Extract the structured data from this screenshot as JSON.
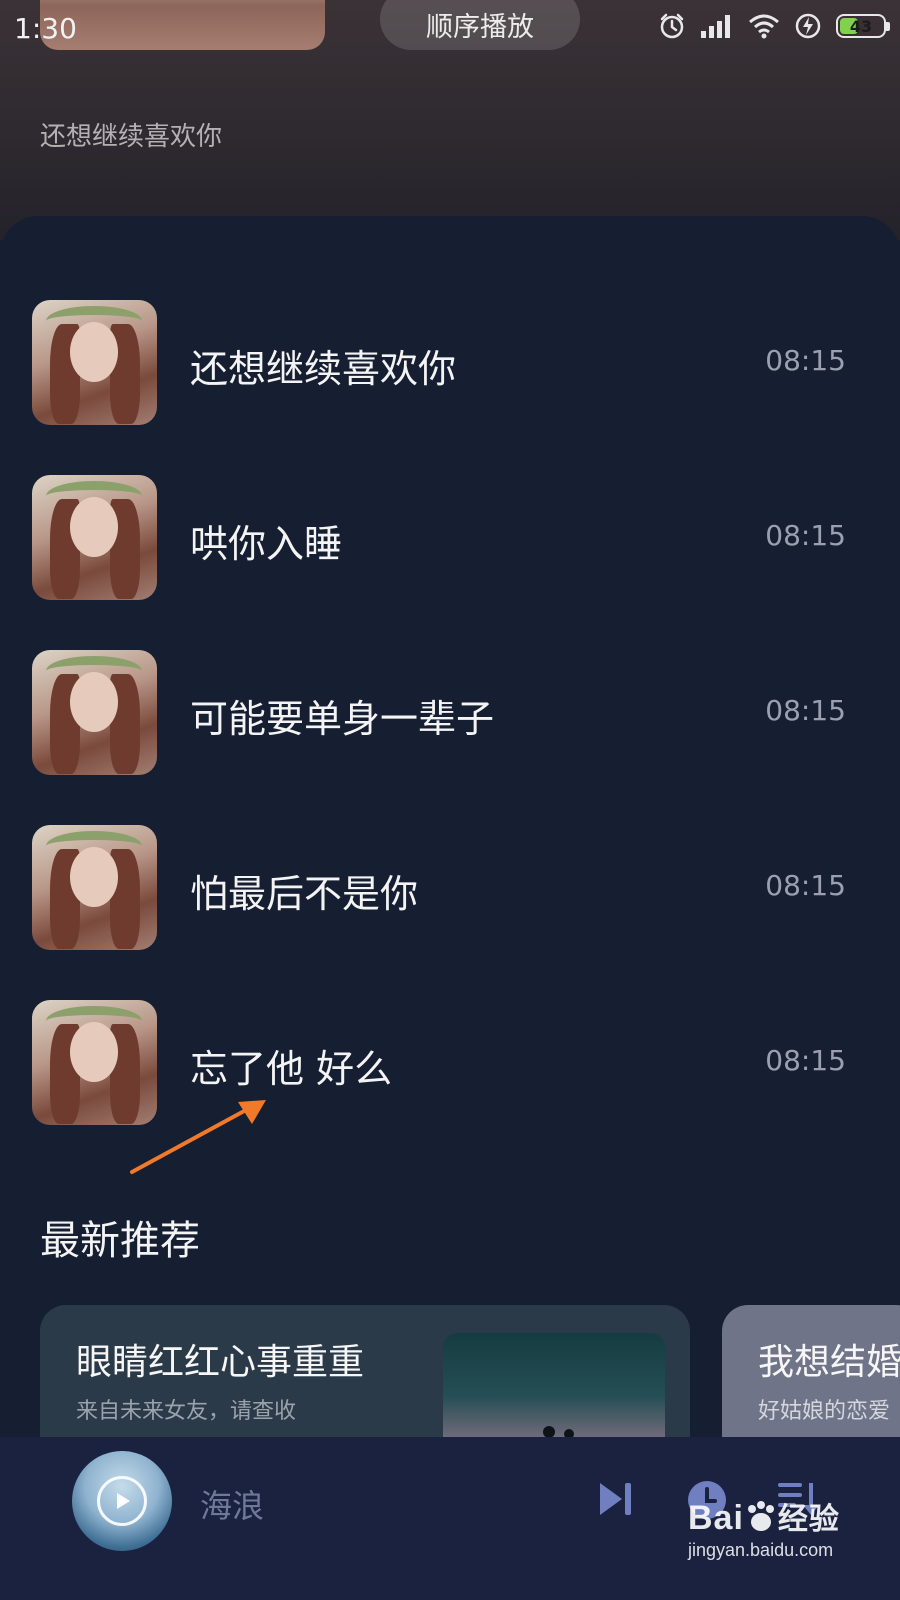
{
  "status_bar": {
    "time": "1:30",
    "battery_level": "43",
    "icons": [
      "alarm-icon",
      "signal-icon",
      "wifi-icon",
      "charging-icon",
      "battery-icon"
    ]
  },
  "header": {
    "play_mode": "顺序播放",
    "current_song": "还想继续喜欢你"
  },
  "playlist": [
    {
      "title": "还想继续喜欢你",
      "duration": "08:15"
    },
    {
      "title": "哄你入睡",
      "duration": "08:15"
    },
    {
      "title": "可能要单身一辈子",
      "duration": "08:15"
    },
    {
      "title": "怕最后不是你",
      "duration": "08:15"
    },
    {
      "title": "忘了他 好么",
      "duration": "08:15"
    }
  ],
  "recommendations": {
    "section_title": "最新推荐",
    "items": [
      {
        "title": "眼睛红红心事重重",
        "subtitle": "来自未来女友，请查收"
      },
      {
        "title": "我想结婚",
        "subtitle": "好姑娘的恋爱"
      }
    ]
  },
  "player": {
    "title": "海浪",
    "buttons": [
      "next-icon",
      "timer-icon",
      "playlist-icon"
    ]
  },
  "watermark": {
    "logo_latin": "Bai",
    "logo_cn": "经验",
    "url": "jingyan.baidu.com"
  },
  "colors": {
    "background": "#161e32",
    "player_bar": "#1a2240",
    "annotation_arrow": "#f07a2a",
    "battery_fill": "#7fd24a"
  }
}
